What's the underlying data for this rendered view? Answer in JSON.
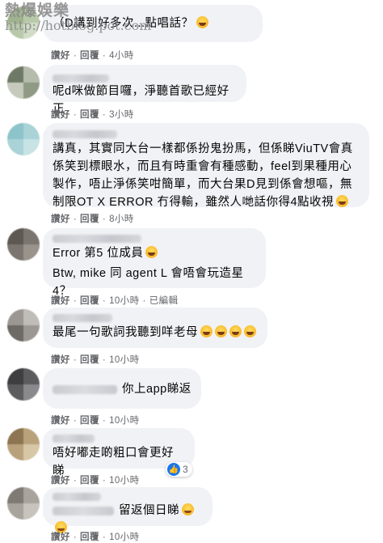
{
  "watermark": {
    "title": "熱爆娛樂",
    "url": "http://hotblog.pot.com"
  },
  "actions": {
    "like": "讚好",
    "reply": "回覆",
    "edited": "已編輯"
  },
  "comments": [
    {
      "text": "（D講到好多次...點唱話？",
      "time": "4小時"
    },
    {
      "text": "呢d咪做節目囉，淨聽首歌已經好正",
      "time": "3小時"
    },
    {
      "text": "講真，其實同大台一樣都係扮鬼扮馬，但係睇ViuTV會真係笑到標眼水，而且有時重會有種感動，feel到果種用心製作，唔止淨係笑咁簡單，而大台果D見到係會想嘔，無制限OT X ERROR 冇得輸，雖然人哋話你得4點收視",
      "time": "8小時"
    },
    {
      "text": "Error 第5 位成員",
      "text2": "Btw, mike 同 agent L 會唔會玩造星4？",
      "time": "10小時"
    },
    {
      "text": "最尾一句歌詞我聽到咩老母",
      "time": "10小時"
    },
    {
      "text": "你上app睇返",
      "time": "10小時"
    },
    {
      "text": "唔好嘟走啲粗口會更好睇",
      "time": "10小時",
      "reactions": "3"
    },
    {
      "text": "留返個日睇",
      "time": "10小時"
    }
  ]
}
